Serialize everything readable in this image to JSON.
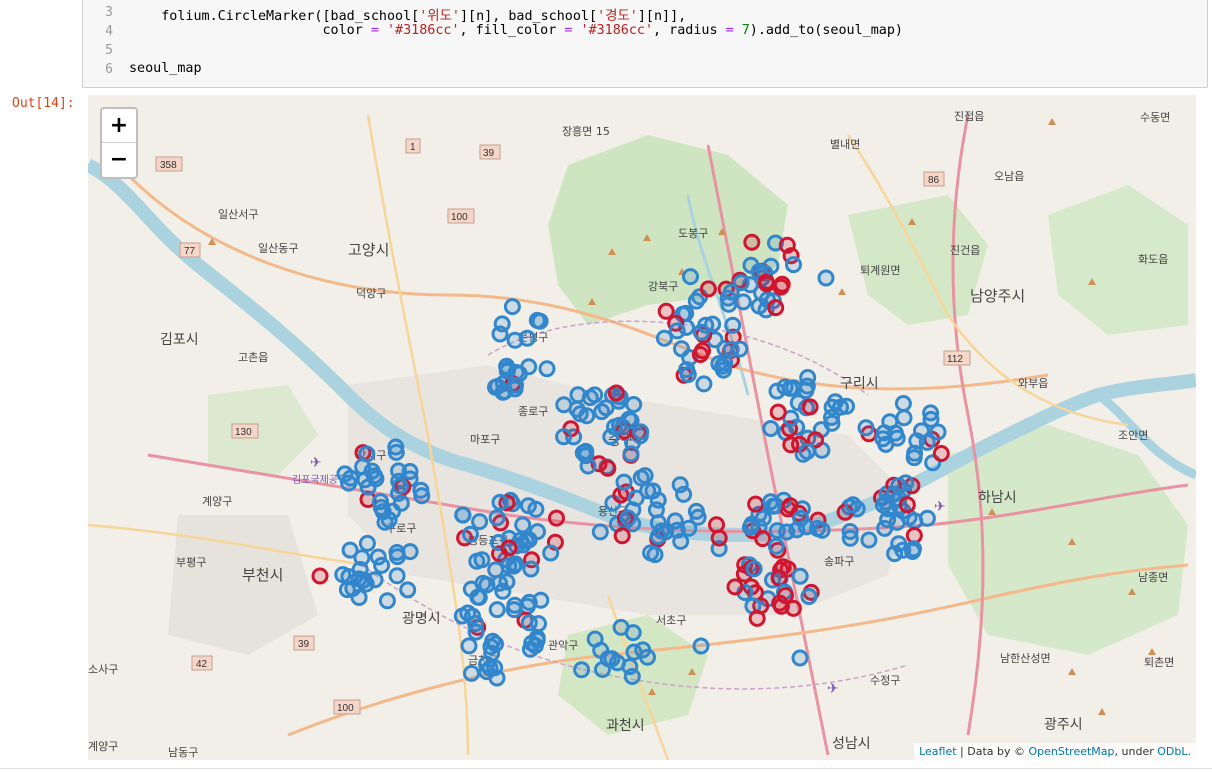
{
  "code": {
    "line_numbers": [
      "3",
      "4",
      "5",
      "6"
    ],
    "line3_a": "    folium.CircleMarker([bad_school[",
    "line3_s1": "'위도'",
    "line3_b": "][n], bad_school[",
    "line3_s2": "'경도'",
    "line3_c": "][n]],",
    "line4_a": "                        color ",
    "line4_eq1": "=",
    "line4_s1": " '#3186cc'",
    "line4_b": ", fill_color ",
    "line4_eq2": "=",
    "line4_s2": " '#3186cc'",
    "line4_c": ", radius ",
    "line4_eq3": "=",
    "line4_n": " 7",
    "line4_d": ").add_to(seoul_map)",
    "line6": "seoul_map"
  },
  "output_prompt": "Out[14]:",
  "map": {
    "zoom_in": "+",
    "zoom_out": "−",
    "attribution": {
      "leaflet": "Leaflet",
      "sep1": " | Data by © ",
      "osm": "OpenStreetMap",
      "sep2": ", under ",
      "odbl": "ODbL",
      "end": "."
    },
    "labels": {
      "jinjeop": "진접읍",
      "sudongmyeon": "수동면",
      "jangheung": "장흥면 15",
      "byeollae": "별내면",
      "onam": "오남읍",
      "ilsanseo": "일산서구",
      "ilsandong": "일산동구",
      "goyang": "고양시",
      "deokyang": "덕양구",
      "jingeon": "진건읍",
      "hwado": "화도읍",
      "toegyewon": "퇴계원면",
      "namyangju": "남양주시",
      "gimpo": "김포시",
      "gochon": "고촌읍",
      "guri": "구리시",
      "wabu": "와부읍",
      "joan": "조안면",
      "gimpo_airport": "김포국제공항",
      "gyeyang": "계양구",
      "bupyeong": "부평구",
      "bucheon": "부천시",
      "gwangmyeong": "광명시",
      "yongsan": "용산구",
      "hanam": "하남시",
      "namjong": "남종면",
      "seocho": "서초구",
      "sujeong": "수정구",
      "namhansan": "남한산성면",
      "toechon": "퇴촌면",
      "gwacheon": "과천시",
      "gwangju": "광주시",
      "seongnam": "성남시",
      "geumcheon": "금천구",
      "gwanak": "관악구",
      "gangbuk": "강북구",
      "eunpyeong": "은평구",
      "jongno": "종로구",
      "jung": "중구",
      "mapo": "마포구",
      "gangseo": "강서구",
      "yeongdeungpo": "영등포구",
      "guro": "구로구",
      "songpa": "송파구",
      "dobong": "도봉구",
      "sosa": "소사구",
      "namdong": "남동구",
      "gyeyang2": "계양구"
    },
    "colors": {
      "blue": "#3186cc",
      "red": "#d0152f"
    }
  }
}
